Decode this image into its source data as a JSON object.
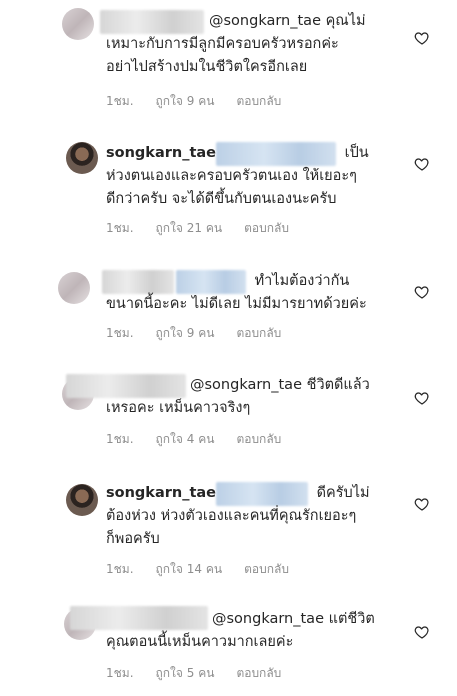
{
  "comments": [
    {
      "mention": "@songkarn_tae",
      "line1_rest": " คุณไม่",
      "line2": "เหมาะกับการมีลูกมีครอบครัวหรอกค่ะ",
      "line3": "อย่าไปสร้างปมในชีวิตใครอีกเลย",
      "time": "1ชม.",
      "likes": "ถูกใจ 9 คน",
      "reply": "ตอบกลับ"
    },
    {
      "username": "songkarn_tae",
      "line1_rest": " เป็น",
      "line2": "ห่วงตนเองและครอบครัวตนเอง ให้เยอะๆ",
      "line3": "ดีกว่าครับ จะได้ดีขึ้นกับตนเองนะครับ",
      "time": "1ชม.",
      "likes": "ถูกใจ 21 คน",
      "reply": "ตอบกลับ"
    },
    {
      "line1_rest": " ทำไมต้องว่ากัน",
      "line2": "ขนาดนี้อะคะ ไม่ดีเลย ไม่มีมารยาทด้วยค่ะ",
      "time": "1ชม.",
      "likes": "ถูกใจ 9 คน",
      "reply": "ตอบกลับ"
    },
    {
      "mention": "@songkarn_tae",
      "line1_rest": " ชีวิตดีแล้ว",
      "line2": "เหรอคะ เหม็นคาวจริงๆ",
      "time": "1ชม.",
      "likes": "ถูกใจ 4 คน",
      "reply": "ตอบกลับ"
    },
    {
      "username": "songkarn_tae",
      "line1_rest": " ดีครับไม่",
      "line2": "ต้องห่วง ห่วงตัวเองและคนที่คุณรักเยอะๆ",
      "line3": "ก็พอครับ",
      "time": "1ชม.",
      "likes": "ถูกใจ 14 คน",
      "reply": "ตอบกลับ"
    },
    {
      "mention": "@songkarn_tae",
      "line1_rest": " แต่ชีวิต",
      "line2": "คุณตอนนี้เหม็นคาวมากเลยค่ะ",
      "time": "1ชม.",
      "likes": "ถูกใจ 5 คน",
      "reply": "ตอบกลับ"
    }
  ],
  "icons": {
    "like": "heart-outline-icon"
  },
  "colors": {
    "meta": "#8e8e8e",
    "text": "#262626"
  }
}
